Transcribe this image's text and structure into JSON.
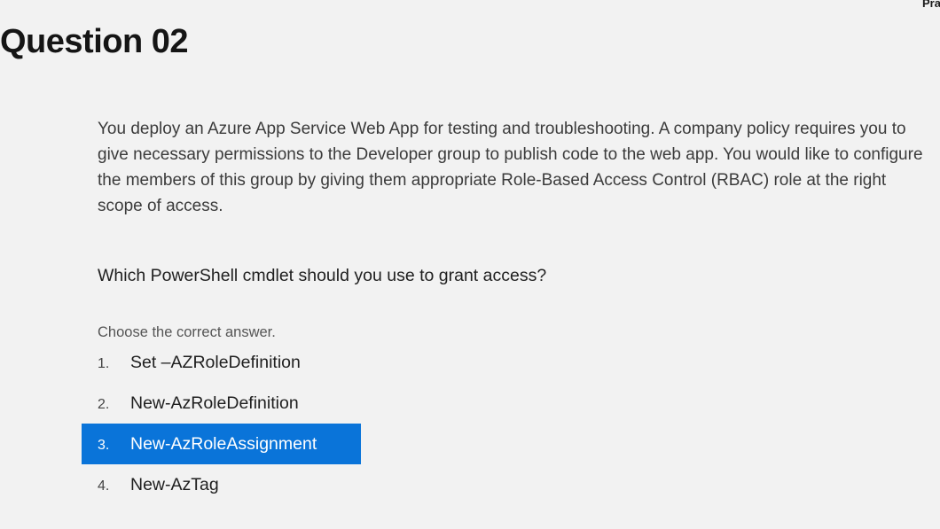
{
  "header": {
    "title": "Question 02",
    "corner_text": "Pra"
  },
  "question": {
    "scenario": "You deploy an Azure App Service Web App for testing and troubleshooting. A company policy requires you to give necessary permissions to the Developer group to publish code to the web app. You would like to configure the members of this group by giving them appropriate Role-Based Access Control (RBAC) role at the right scope of access.",
    "prompt": "Which PowerShell cmdlet should you use to grant access?",
    "instruction": "Choose the correct answer."
  },
  "answers": [
    {
      "number": "1.",
      "text": "Set –AZRoleDefinition",
      "selected": false
    },
    {
      "number": "2.",
      "text": "New-AzRoleDefinition",
      "selected": false
    },
    {
      "number": "3.",
      "text": "New-AzRoleAssignment",
      "selected": true
    },
    {
      "number": "4.",
      "text": "New-AzTag",
      "selected": false
    }
  ],
  "colors": {
    "background": "#f2f2f2",
    "selected_highlight": "#0a74d9"
  }
}
